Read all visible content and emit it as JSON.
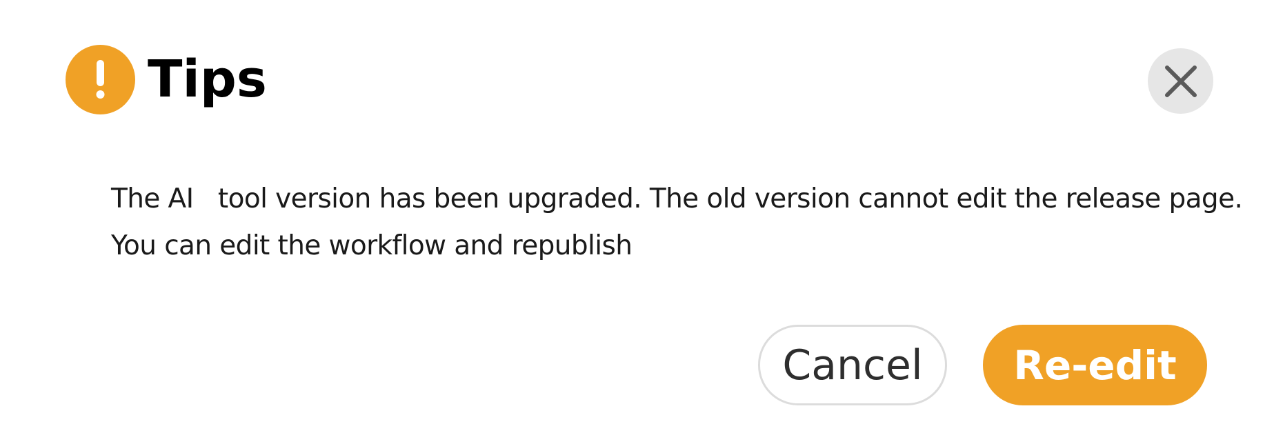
{
  "dialog": {
    "title": "Tips",
    "icon": "warning-circle-icon",
    "close_icon": "close-icon",
    "message_lines": [
      "The AI   tool version has been upgraded. The old version cannot edit the release page.",
      "You can edit the workflow and republish"
    ],
    "buttons": {
      "cancel_label": "Cancel",
      "reedit_label": "Re-edit"
    }
  },
  "colors": {
    "accent": "#f0a126",
    "close_bg": "#e6e6e6",
    "cancel_border": "#dcdcdc"
  }
}
